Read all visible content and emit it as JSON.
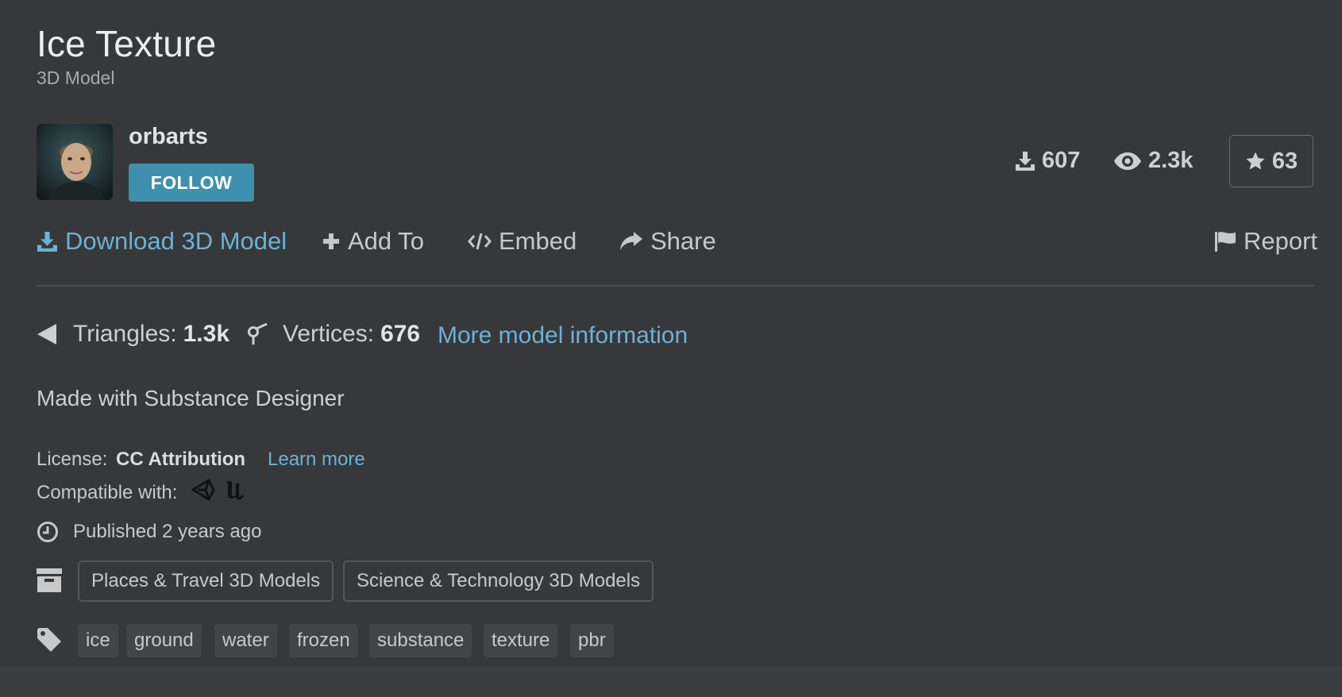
{
  "model": {
    "title": "Ice Texture",
    "subtitle": "3D Model"
  },
  "author": {
    "username": "orbarts",
    "follow_label": "FOLLOW"
  },
  "stats": {
    "downloads": "607",
    "views": "2.3k",
    "likes": "63"
  },
  "actions": {
    "download": "Download 3D Model",
    "add_to": "Add To",
    "embed": "Embed",
    "share": "Share",
    "report": "Report"
  },
  "model_info": {
    "triangles_label": "Triangles:",
    "triangles_value": "1.3k",
    "vertices_label": "Vertices:",
    "vertices_value": "676",
    "more_link": "More model information"
  },
  "description": "Made with Substance Designer",
  "license": {
    "label": "License:",
    "value": "CC Attribution",
    "learn_more": "Learn more"
  },
  "compatibility": {
    "label": "Compatible with:",
    "icons": [
      "unity-icon",
      "unreal-engine-icon"
    ]
  },
  "published": "Published 2 years ago",
  "categories": [
    "Places & Travel 3D Models",
    "Science & Technology 3D Models"
  ],
  "tags": [
    "ice",
    "ground",
    "water",
    "frozen",
    "substance",
    "texture",
    "pbr"
  ],
  "colors": {
    "background": "#37383a",
    "accent": "#6ab3d6",
    "follow_button": "#3f8fae"
  }
}
